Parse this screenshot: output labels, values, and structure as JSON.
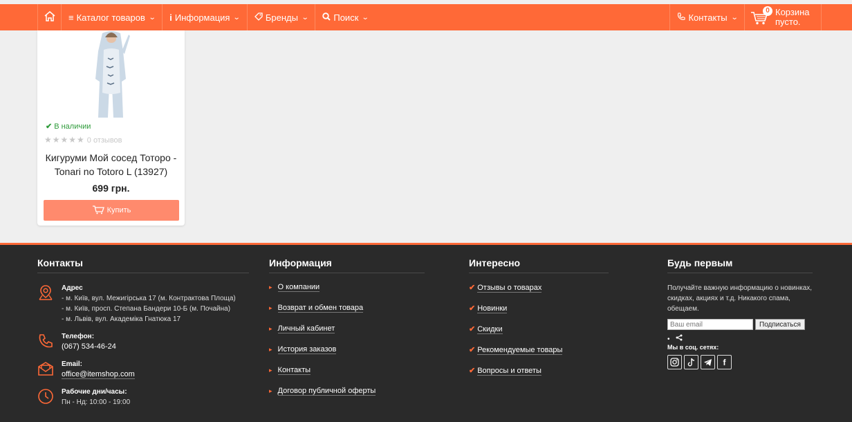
{
  "colors": {
    "accent": "#ff6937",
    "footer_bg": "#2a2a2a",
    "stock_green": "#2e9b3a",
    "buy_button": "#ff8a6d"
  },
  "nav": {
    "home_icon": "home-icon",
    "catalog": "Каталог товаров",
    "info": "Информация",
    "brands": "Бренды",
    "search": "Поиск",
    "contacts": "Контакты",
    "cart_count": "0",
    "cart_line1": "Корзина",
    "cart_line2": "пусто."
  },
  "product": {
    "stock": "В наличии",
    "reviews": "0 отзывов",
    "rating": 0,
    "title": "Кигуруми Мой сосед Тоторо - Tonari no Totoro L (13927)",
    "price": "699 грн.",
    "buy": "Купить"
  },
  "footer": {
    "contacts": {
      "title": "Контакты",
      "address_label": "Адрес",
      "address_lines": [
        "- м. Київ, вул. Межигірська 17 (м. Контрактова Площа)",
        "- м. Київ, просп. Степана Бандери 10-Б (м. Почайна)",
        "- м. Львів, вул. Академіка Гнатюка 17"
      ],
      "phone_label": "Телефон:",
      "phone": "(067) 534-46-24",
      "email_label": "Email:",
      "email": "office@itemshop.com",
      "hours_label": "Рабочие дни/часы:",
      "hours": "Пн - Нд: 10:00 - 19:00"
    },
    "info": {
      "title": "Информация",
      "links": [
        "О компании",
        "Возврат и обмен товара",
        "Личный кабинет",
        "История заказов",
        "Контакты",
        "Договор публичной оферты"
      ]
    },
    "interesting": {
      "title": "Интересно",
      "links": [
        "Отзывы о товарах",
        "Новинки",
        "Скидки",
        "Рекомендуемые товары",
        "Вопросы и ответы"
      ]
    },
    "subscribe": {
      "title": "Будь первым",
      "text": "Получайте важную информацию о новинках, скидках, акциях и т.д. Никакого спама, обещаем.",
      "placeholder": "Ваш email",
      "button": "Подписаться",
      "share_bullet": "•",
      "social_title": "Мы в соц. сетях:"
    }
  }
}
